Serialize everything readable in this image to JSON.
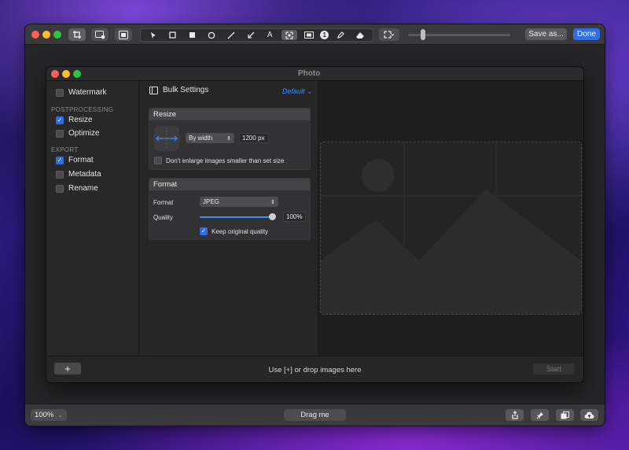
{
  "outer_toolbar": {
    "save_as_label": "Save as...",
    "done_label": "Done",
    "tools": [
      "select-arrow-icon",
      "rectangle-outline-icon",
      "rectangle-filled-icon",
      "circle-icon",
      "line-icon",
      "arrow-icon",
      "text-icon",
      "pixelate-icon",
      "highlight-icon",
      "counter-icon",
      "pencil-icon",
      "eraser-icon"
    ],
    "counter_label": "1",
    "text_tool_label": "A"
  },
  "inner_window": {
    "title": "Photo",
    "sidebar": {
      "watermark_label": "Watermark",
      "postprocessing_heading": "POSTPROCESSING",
      "resize_label": "Resize",
      "optimize_label": "Optimize",
      "export_heading": "EXPORT",
      "format_label": "Format",
      "metadata_label": "Metadata",
      "rename_label": "Rename",
      "checked": {
        "watermark": false,
        "resize": true,
        "optimize": false,
        "format": true,
        "metadata": false,
        "rename": false
      }
    },
    "settings": {
      "title": "Bulk Settings",
      "preset": "Default",
      "resize": {
        "heading": "Resize",
        "mode": "By width",
        "width_value": "1200 px",
        "dont_enlarge_label": "Don't enlarge images smaller than set size",
        "dont_enlarge_checked": false
      },
      "format": {
        "heading": "Format",
        "format_label": "Format",
        "format_value": "JPEG",
        "quality_label": "Quality",
        "quality_value": "100%",
        "quality_fraction": 1.0,
        "keep_quality_label": "Keep original quality",
        "keep_quality_checked": true
      }
    },
    "bottom": {
      "add_label": "+",
      "hint": "Use [+] or drop images here",
      "start_label": "Start"
    }
  },
  "outer_bottom": {
    "zoom_value": "100%",
    "drag_label": "Drag me"
  },
  "colors": {
    "accent": "#2f6de1",
    "link": "#3f8cff",
    "close": "#fe5f57",
    "minimize": "#febc2e",
    "zoom": "#28c840"
  }
}
